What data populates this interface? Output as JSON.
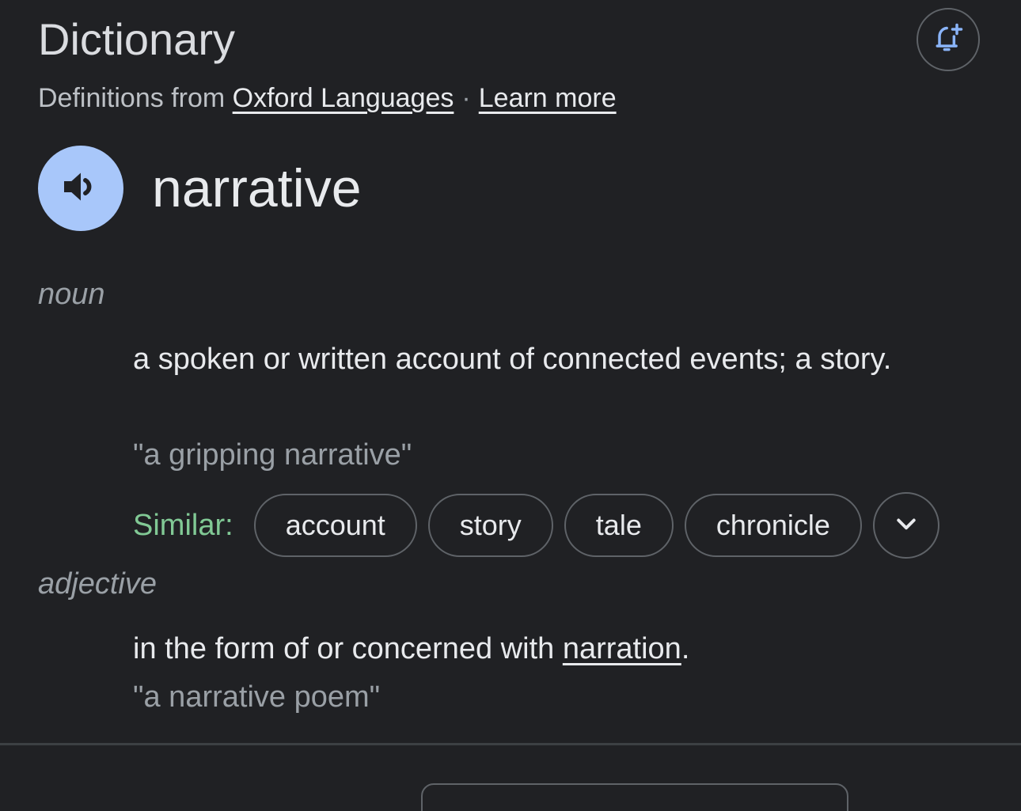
{
  "header": {
    "title": "Dictionary",
    "alert_icon": "bell-plus-icon"
  },
  "source": {
    "prefix": "Definitions from",
    "source_link": "Oxford Languages",
    "separator": "·",
    "learn_more": "Learn more"
  },
  "entry": {
    "word": "narrative",
    "speaker_icon": "speaker-icon"
  },
  "senses": [
    {
      "part_of_speech": "noun",
      "definition": "a spoken or written account of connected events; a story.",
      "example": "\"a gripping narrative\"",
      "similar_label": "Similar:",
      "similar": [
        "account",
        "story",
        "tale",
        "chronicle"
      ],
      "expand_icon": "chevron-down-icon"
    },
    {
      "part_of_speech": "adjective",
      "definition_prefix": "in the form of or concerned with ",
      "definition_link": "narration",
      "definition_suffix": ".",
      "example": "\"a narrative poem\""
    }
  ],
  "colors": {
    "background": "#202124",
    "speaker_button": "#a8c7fa",
    "similar_label": "#81c995",
    "chip_border": "#5f6368",
    "accent_icon": "#8ab4f8"
  }
}
